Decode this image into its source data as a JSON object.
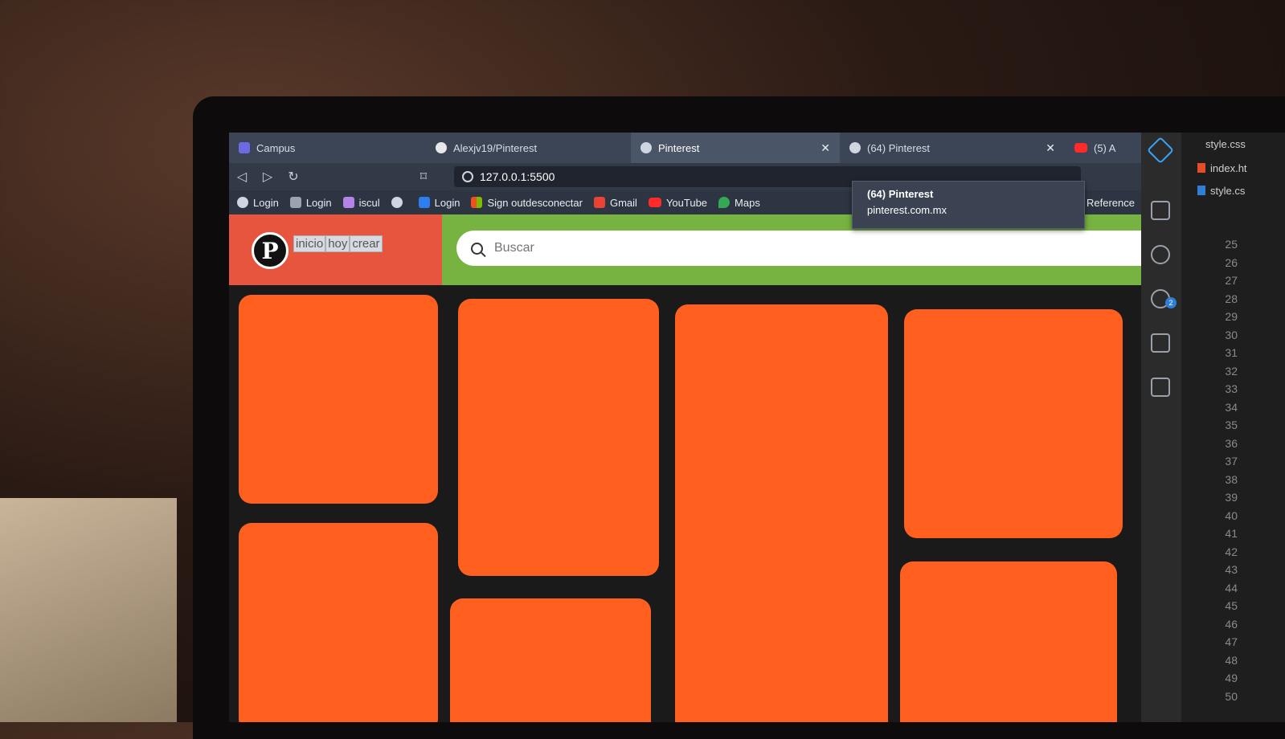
{
  "browser": {
    "tabs": [
      {
        "title": "Campus",
        "icon": "campus-icon"
      },
      {
        "title": "Alexjv19/Pinterest",
        "icon": "github-icon"
      },
      {
        "title": "Pinterest",
        "icon": "globe-icon",
        "active": true
      },
      {
        "title": "(64) Pinterest",
        "icon": "globe-icon"
      },
      {
        "title": "(5) A",
        "icon": "youtube-icon"
      }
    ],
    "close_glyph": "✕",
    "address": "127.0.0.1:5500",
    "bookmarks": [
      {
        "label": "Login",
        "icon": "globe-icon"
      },
      {
        "label": "Login",
        "icon": "app-icon"
      },
      {
        "label": "iscul",
        "icon": "app-icon"
      },
      {
        "label": "",
        "icon": "globe-icon"
      },
      {
        "label": "Login",
        "icon": "atlassian-icon"
      },
      {
        "label": "Sign outdesconectar",
        "icon": "microsoft-icon"
      },
      {
        "label": "Gmail",
        "icon": "gmail-icon"
      },
      {
        "label": "YouTube",
        "icon": "youtube-icon"
      },
      {
        "label": "Maps",
        "icon": "maps-icon"
      }
    ],
    "tooltip": {
      "title": "(64) Pinterest",
      "url": "pinterest.com.mx"
    },
    "overflow_label": "Reference"
  },
  "page": {
    "logo_letter": "P",
    "nav": [
      "inicio",
      "hoy",
      "crear"
    ],
    "search_placeholder": "Buscar",
    "colors": {
      "header_left": "#e8553f",
      "header_right": "#77b341",
      "card": "#ff5f1f"
    }
  },
  "vscode": {
    "tabs": [
      "style.css",
      "index.ht",
      "style.cs"
    ],
    "line_numbers": [
      "25",
      "26",
      "27",
      "28",
      "29",
      "30",
      "31",
      "32",
      "33",
      "34",
      "35",
      "36",
      "37",
      "38",
      "39",
      "40",
      "41",
      "42",
      "43",
      "44",
      "45",
      "46",
      "47",
      "48",
      "49",
      "50"
    ],
    "extension_badge": "2"
  }
}
